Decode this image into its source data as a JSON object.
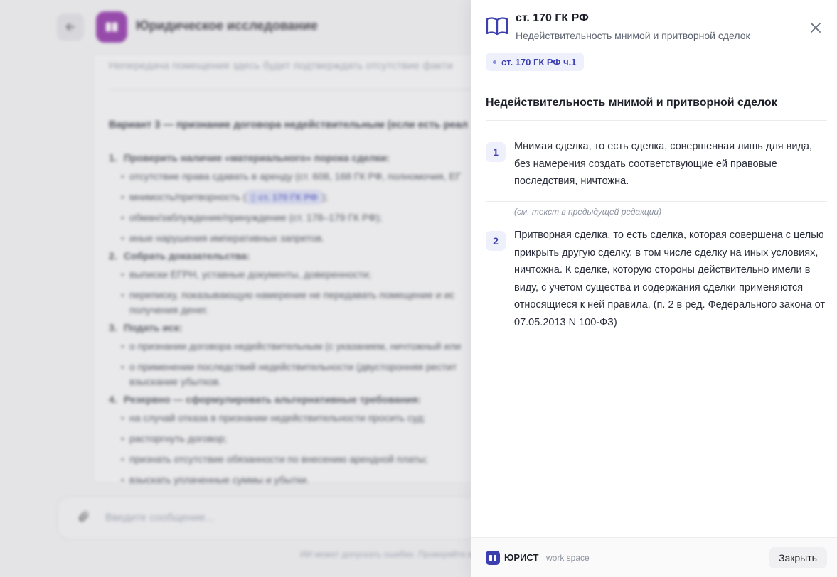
{
  "background": {
    "app_title": "Юридическое исследование",
    "doc_top_line": "Непередача помещения здесь будет подтверждать отсутствие факти",
    "variant_heading": "Вариант 3 — признание договора недействительным (если есть реал",
    "steps": [
      {
        "num": "1.",
        "title": "Проверить наличие «материального» порока сделки:",
        "items": [
          "отсутствие права сдавать в аренду (ст. 608, 168 ГК РФ, полномочия, ЕГ",
          "мнимость/притворность (",
          "обман/заблуждение/принуждение (ст. 178–179 ГК РФ);",
          "иные нарушения императивных запретов."
        ]
      },
      {
        "num": "2.",
        "title": "Собрать доказательства:",
        "items": [
          "выписки ЕГРН, уставные документы, доверенности;",
          "переписку, показывающую намерение не передавать помещение и ис",
          "получения денег."
        ]
      },
      {
        "num": "3.",
        "title": "Подать иск:",
        "items": [
          "о признании договора недействительным (с указанием, ничтожный или",
          "о применении последствий недействительности (двусторонняя рестит",
          "взыскание убытков."
        ]
      },
      {
        "num": "4.",
        "title_plain": "Резервно — сформулировать ",
        "title_bold": "альтернативные требования",
        "title_end": ":",
        "items": [
          "на случай отказа в признании недействительности просить суд:",
          "расторгнуть договор;",
          "признать отсутствие обязанности по внесению арендной платы;",
          "взыскать уплаченные суммы и убытки."
        ]
      }
    ],
    "inline_chip": "ст. 170 ГК РФ",
    "inline_chip_end": ");",
    "input_placeholder": "Введите сообщение...",
    "disclaimer": "ИИ может допускать ошибки. Проверяйте важ"
  },
  "panel": {
    "title": "ст. 170 ГК РФ",
    "subtitle": "Недействительность мнимой и притворной сделок",
    "tag": "ст. 170 ГК РФ ч.1",
    "heading": "Недействительность мнимой и притворной сделок",
    "paragraphs": [
      {
        "num": "1",
        "text": "Мнимая сделка, то есть сделка, совершенная лишь для вида, без намерения создать соответствующие ей правовые последствия, ничтожна."
      },
      {
        "num": "2",
        "text": "Притворная сделка, то есть сделка, которая совершена с целью прикрыть другую сделку, в том числе сделку на иных условиях, ничтожна. К сделке, которую стороны действительно имели в виду, с учетом существа и содержания сделки применяются относящиеся к ней правила. (п. 2 в ред. Федерального закона от 07.05.2013 N 100-ФЗ)"
      }
    ],
    "note": "(см. текст в предыдущей редакции)",
    "footer": {
      "brand": "ЮРИСТ",
      "brand_suffix": "work space",
      "close_label": "Закрыть"
    }
  },
  "colors": {
    "accent": "#3c3fae",
    "app_logo": "#8d2aa6",
    "tag_bg": "#eef0fc"
  }
}
